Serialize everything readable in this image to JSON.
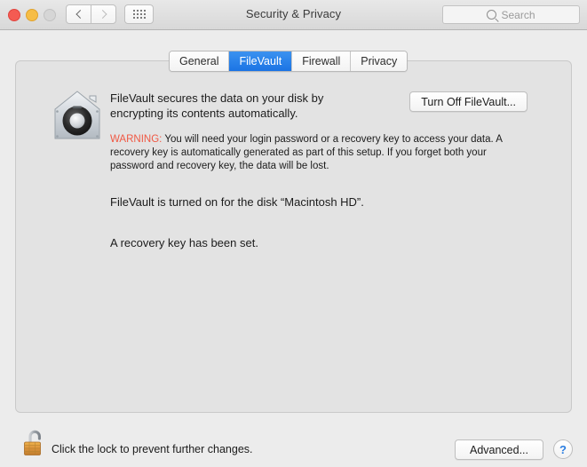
{
  "window": {
    "title": "Security & Privacy",
    "traffic_lights": [
      {
        "name": "close",
        "color": "#f45b52"
      },
      {
        "name": "minimize",
        "color": "#f6bd46"
      },
      {
        "name": "zoom",
        "color": "#d6d6d6"
      }
    ],
    "toolbar": {
      "back_icon": "chevron-left-icon",
      "forward_icon": "chevron-right-icon",
      "show_all_icon": "grid-icon"
    },
    "search": {
      "icon": "search-icon",
      "placeholder": "Search",
      "value": ""
    }
  },
  "tabs": [
    {
      "label": "General",
      "selected": false
    },
    {
      "label": "FileVault",
      "selected": true
    },
    {
      "label": "Firewall",
      "selected": false
    },
    {
      "label": "Privacy",
      "selected": false
    }
  ],
  "filevault": {
    "icon": "filevault-vault-icon",
    "description": "FileVault secures the data on your disk by encrypting its contents automatically.",
    "turn_off_button": "Turn Off FileVault...",
    "warning_label": "WARNING:",
    "warning_text": " You will need your login password or a recovery key to access your data. A recovery key is automatically generated as part of this setup. If you forget both your password and recovery key, the data will be lost.",
    "warning_color": "#f05843",
    "status_line_1": "FileVault is turned on for the disk “Macintosh HD”.",
    "status_line_2": "A recovery key has been set."
  },
  "footer": {
    "lock_icon": "unlocked-padlock-icon",
    "lock_text": "Click the lock to prevent further changes.",
    "advanced_button": "Advanced...",
    "help_button": "?",
    "help_color": "#2a7de1"
  }
}
